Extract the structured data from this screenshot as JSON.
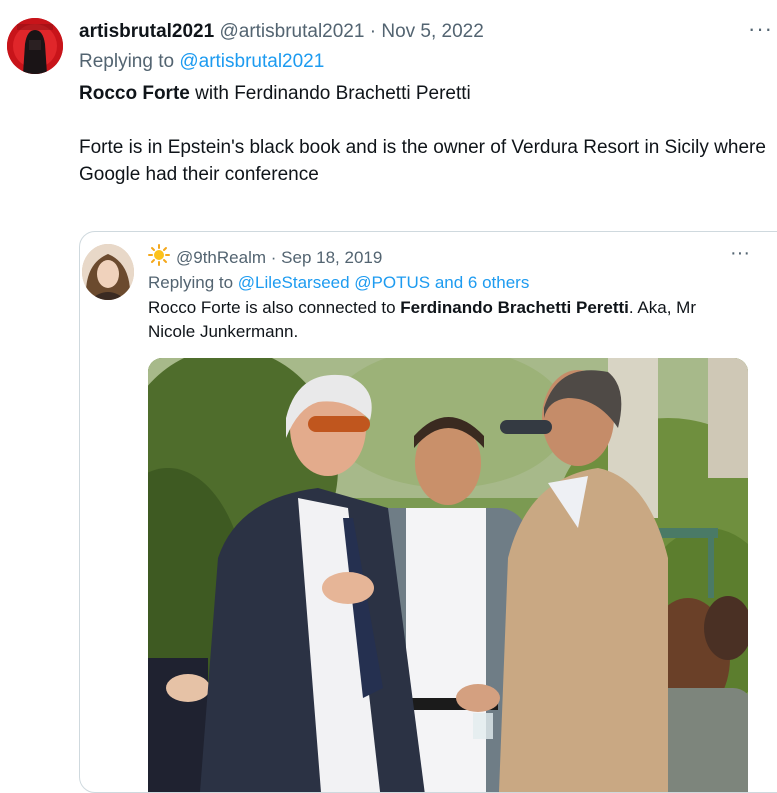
{
  "tweet": {
    "display_name": "artisbrutal2021",
    "handle": "@artisbrutal2021",
    "separator": "·",
    "date": "Nov 5, 2022",
    "more_icon": "···",
    "replying_prefix": "Replying to",
    "replying_handle": "@artisbrutal2021",
    "line1_bold": "Rocco Forte",
    "line1_rest": " with Ferdinando Brachetti Peretti",
    "paragraph2": "Forte is in Epstein's black book and is the owner of Verdura Resort in Sicily where Google had their conference"
  },
  "quote": {
    "emoji_icon": "sun-emoji-icon",
    "handle": "@9thRealm",
    "separator": "·",
    "date": "Sep 18, 2019",
    "more_icon": "···",
    "replying_prefix": "Replying to",
    "replying_handles": "@LileStarseed @POTUS and 6 others",
    "text_part1": "Rocco Forte is also connected to ",
    "text_bold": "Ferdinando Brachetti Peretti",
    "text_part2": ". Aka, Mr Nicole Junkermann."
  },
  "colors": {
    "text": "#0f1419",
    "secondary": "#536471",
    "link": "#1d9bf0",
    "border": "#cfd9de"
  }
}
